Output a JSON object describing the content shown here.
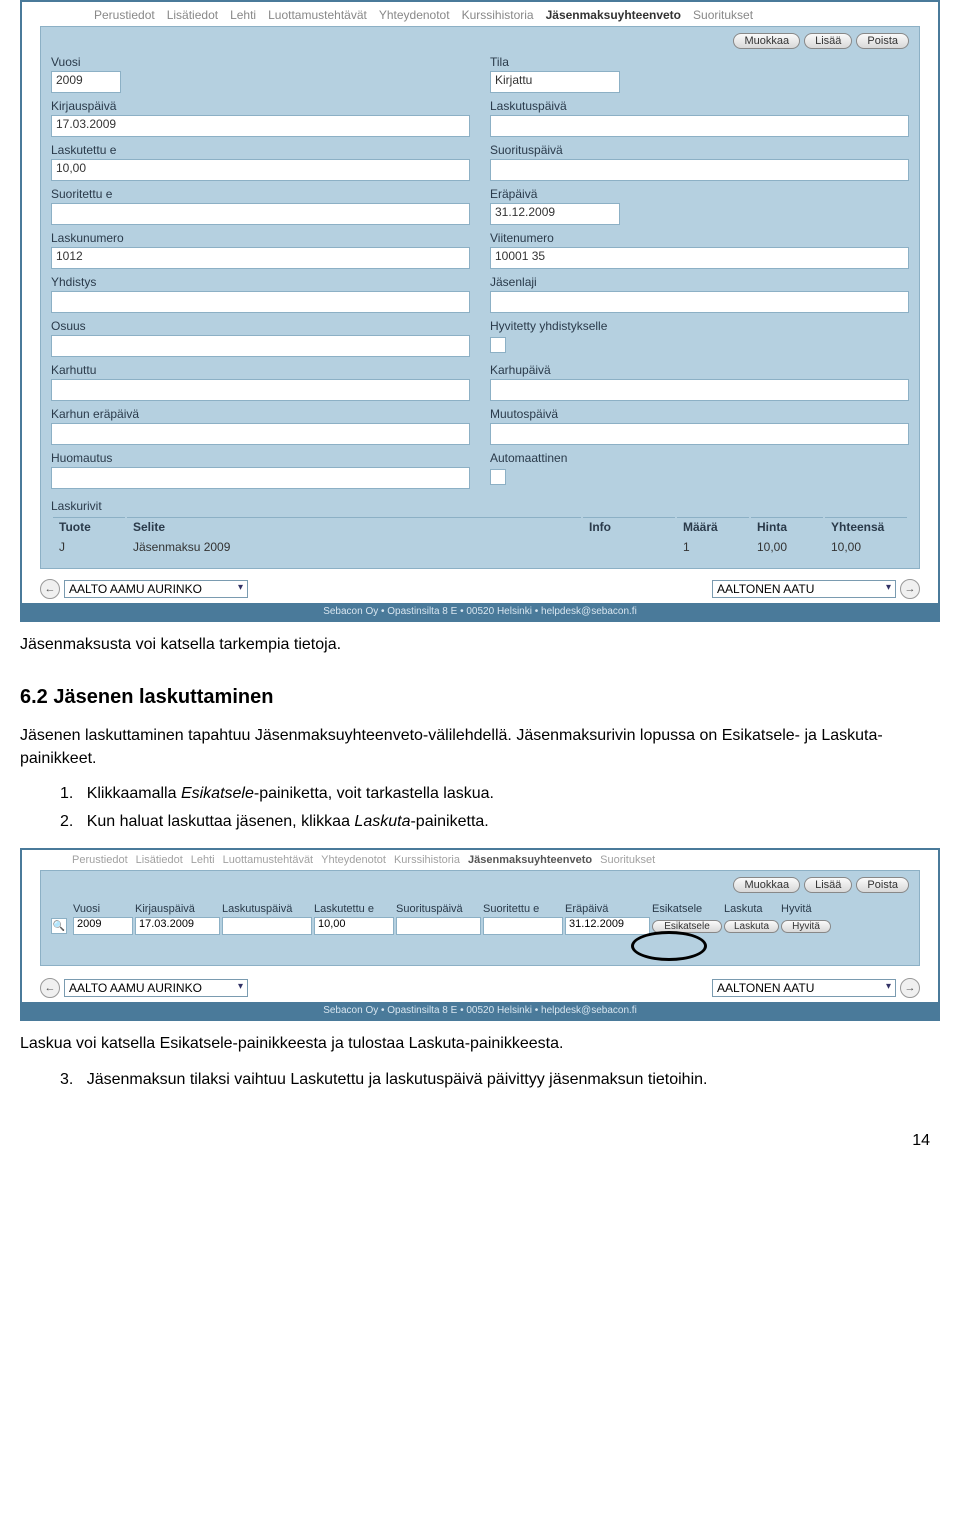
{
  "tabs": [
    "Perustiedot",
    "Lisätiedot",
    "Lehti",
    "Luottamustehtävät",
    "Yhteydenotot",
    "Kurssihistoria",
    "Jäsenmaksuyhteenveto",
    "Suoritukset"
  ],
  "toolbar": {
    "muokkaa": "Muokkaa",
    "lisaa": "Lisää",
    "poista": "Poista"
  },
  "fields": {
    "vuosi": {
      "label": "Vuosi",
      "value": "2009"
    },
    "tila": {
      "label": "Tila",
      "value": "Kirjattu"
    },
    "kirjauspaiva": {
      "label": "Kirjauspäivä",
      "value": "17.03.2009"
    },
    "laskutuspaiva": {
      "label": "Laskutuspäivä",
      "value": ""
    },
    "laskutettu": {
      "label": "Laskutettu e",
      "value": "10,00"
    },
    "suorituspaiva": {
      "label": "Suorituspäivä",
      "value": ""
    },
    "suoritettu": {
      "label": "Suoritettu e",
      "value": ""
    },
    "erapaiva": {
      "label": "Eräpäivä",
      "value": "31.12.2009"
    },
    "laskunumero": {
      "label": "Laskunumero",
      "value": "1012"
    },
    "viitenumero": {
      "label": "Viitenumero",
      "value": "10001 35"
    },
    "yhdistys": {
      "label": "Yhdistys",
      "value": ""
    },
    "jasenlaji": {
      "label": "Jäsenlaji",
      "value": ""
    },
    "osuus": {
      "label": "Osuus",
      "value": ""
    },
    "hyvitetty": {
      "label": "Hyvitetty yhdistykselle"
    },
    "karhuttu": {
      "label": "Karhuttu",
      "value": ""
    },
    "karhupaiva": {
      "label": "Karhupäivä",
      "value": ""
    },
    "karhunera": {
      "label": "Karhun eräpäivä",
      "value": ""
    },
    "muutospaiva": {
      "label": "Muutospäivä",
      "value": ""
    },
    "huomautus": {
      "label": "Huomautus",
      "value": ""
    },
    "automaattinen": {
      "label": "Automaattinen"
    }
  },
  "lines": {
    "title": "Laskurivit",
    "headers": [
      "Tuote",
      "Selite",
      "Info",
      "Määrä",
      "Hinta",
      "Yhteensä"
    ],
    "rows": [
      [
        "J",
        "Jäsenmaksu 2009",
        "",
        "1",
        "10,00",
        "10,00"
      ]
    ]
  },
  "nav": {
    "left": "AALTO AAMU AURINKO",
    "right": "AALTONEN AATU"
  },
  "footer": "Sebacon Oy • Opastinsilta 8 E • 00520 Helsinki • helpdesk@sebacon.fi",
  "doc": {
    "p1": "Jäsenmaksusta voi katsella tarkempia tietoja.",
    "h2": "6.2   Jäsenen laskuttaminen",
    "p2a": "Jäsenen laskuttaminen tapahtuu Jäsenmaksuyhteenveto-välilehdellä. Jäsenmaksurivin lopussa on Esikatsele- ja Laskuta-painikkeet.",
    "li1a": "Klikkaamalla ",
    "li1em": "Esikatsele",
    "li1b": "-painiketta, voit tarkastella laskua.",
    "li2a": "Kun haluat laskuttaa jäsenen, klikkaa ",
    "li2em": "Laskuta",
    "li2b": "-painiketta.",
    "p3a": "Laskua voi katsella Esikatsele-painikkeesta ja tulostaa Laskuta-painikkeesta.",
    "li3": "Jäsenmaksun tilaksi vaihtuu Laskutettu ja laskutuspäivä päivittyy jäsenmaksun tietoihin.",
    "pagenum": "14"
  },
  "grid2": {
    "headers": [
      "",
      "Vuosi",
      "Kirjauspäivä",
      "Laskutuspäivä",
      "Laskutettu e",
      "Suorituspäivä",
      "Suoritettu e",
      "Eräpäivä",
      "Esikatsele",
      "Laskuta",
      "Hyvitä"
    ],
    "row": {
      "vuosi": "2009",
      "kirjaus": "17.03.2009",
      "laskutus": "",
      "laskutettu": "10,00",
      "suorpaiva": "",
      "suoritettu": "",
      "era": "31.12.2009",
      "esikatsele": "Esikatsele",
      "laskuta": "Laskuta",
      "hyvita": "Hyvitä"
    }
  }
}
